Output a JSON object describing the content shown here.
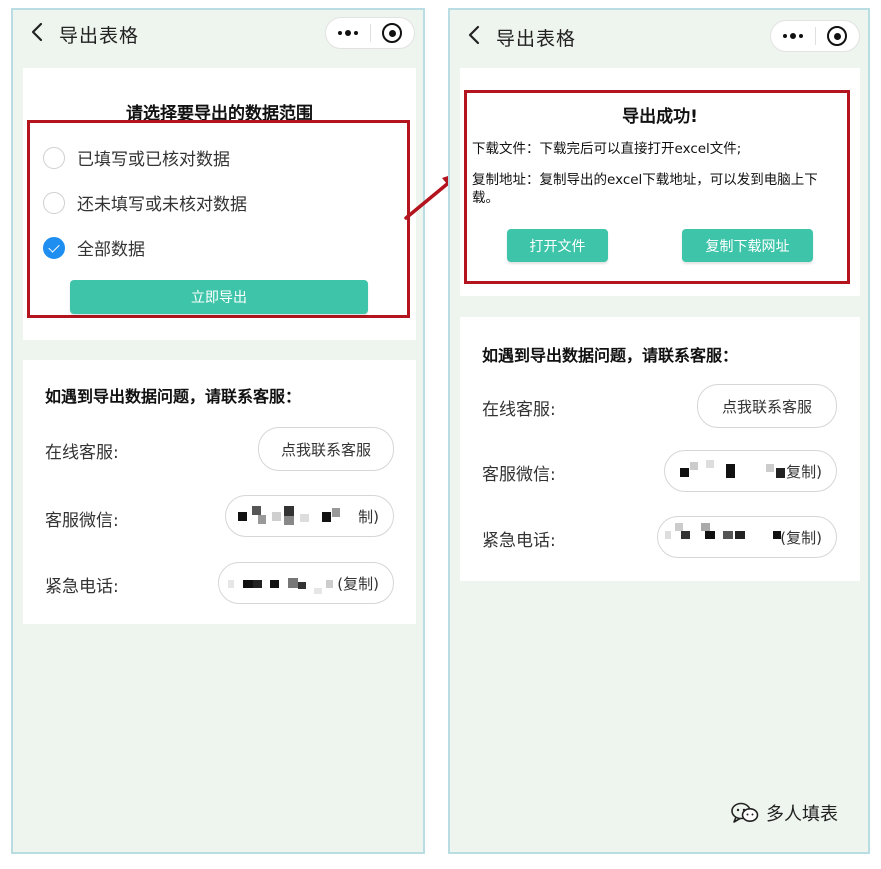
{
  "left": {
    "nav": {
      "title": "导出表格"
    },
    "export": {
      "heading": "请选择要导出的数据范围",
      "options": [
        {
          "label": "已填写或已核对数据",
          "checked": false
        },
        {
          "label": "还未填写或未核对数据",
          "checked": false
        },
        {
          "label": "全部数据",
          "checked": true
        }
      ],
      "export_button": "立即导出"
    },
    "contact": {
      "title": "如遇到导出数据问题，请联系客服：",
      "online_label": "在线客服:",
      "online_button": "点我联系客服",
      "wechat_label": "客服微信:",
      "wechat_suffix": "制)",
      "phone_label": "紧急电话:",
      "phone_suffix": "(复制)"
    }
  },
  "right": {
    "nav": {
      "title": "导出表格"
    },
    "success": {
      "title": "导出成功!",
      "download_line": "下载文件：下载完后可以直接打开excel文件;",
      "copy_line": "复制地址：复制导出的excel下载地址，可以发到电脑上下载。",
      "open_button": "打开文件",
      "copy_button": "复制下载网址"
    },
    "contact": {
      "title": "如遇到导出数据问题，请联系客服：",
      "online_label": "在线客服:",
      "online_button": "点我联系客服",
      "wechat_label": "客服微信:",
      "wechat_suffix": "复制)",
      "phone_label": "紧急电话:",
      "phone_suffix": "(复制)"
    }
  },
  "watermark": {
    "text": "多人填表",
    "icon": "wechat-icon"
  },
  "colors": {
    "accent_green": "#3ec5a9",
    "highlight_red": "#b3141e",
    "radio_blue": "#1e8ef0",
    "page_bg": "#eef4ee"
  }
}
